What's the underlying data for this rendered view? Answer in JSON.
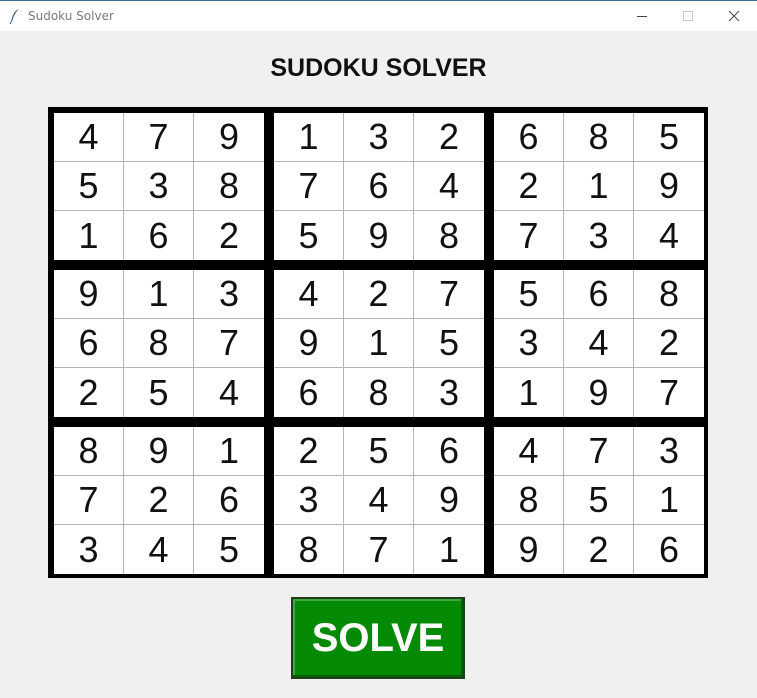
{
  "window": {
    "title": "Sudoku Solver",
    "icon": "feather-icon",
    "controls": [
      "minimize-icon",
      "maximize-icon",
      "close-icon"
    ]
  },
  "heading": "SUDOKU SOLVER",
  "grid": [
    [
      "4",
      "7",
      "9",
      "1",
      "3",
      "2",
      "6",
      "8",
      "5"
    ],
    [
      "5",
      "3",
      "8",
      "7",
      "6",
      "4",
      "2",
      "1",
      "9"
    ],
    [
      "1",
      "6",
      "2",
      "5",
      "9",
      "8",
      "7",
      "3",
      "4"
    ],
    [
      "9",
      "1",
      "3",
      "4",
      "2",
      "7",
      "5",
      "6",
      "8"
    ],
    [
      "6",
      "8",
      "7",
      "9",
      "1",
      "5",
      "3",
      "4",
      "2"
    ],
    [
      "2",
      "5",
      "4",
      "6",
      "8",
      "3",
      "1",
      "9",
      "7"
    ],
    [
      "8",
      "9",
      "1",
      "2",
      "5",
      "6",
      "4",
      "7",
      "3"
    ],
    [
      "7",
      "2",
      "6",
      "3",
      "4",
      "9",
      "8",
      "5",
      "1"
    ],
    [
      "3",
      "4",
      "5",
      "8",
      "7",
      "1",
      "9",
      "2",
      "6"
    ]
  ],
  "solve_button": {
    "label": "SOLVE",
    "color": "#048a04"
  }
}
